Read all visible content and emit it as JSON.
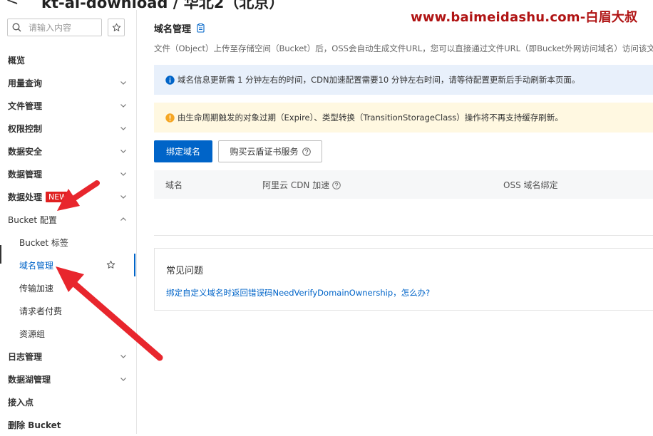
{
  "header": {
    "back_glyph": "<",
    "title": "kt-ai-download / 华北2（北京）"
  },
  "watermark": "www.baimeidashu.com-白眉大叔",
  "sidebar": {
    "search_placeholder": "请输入内容",
    "items": [
      {
        "label": "概览"
      },
      {
        "label": "用量查询"
      },
      {
        "label": "文件管理"
      },
      {
        "label": "权限控制"
      },
      {
        "label": "数据安全"
      },
      {
        "label": "数据管理"
      },
      {
        "label": "数据处理",
        "badge": "NEW"
      },
      {
        "label": "Bucket 配置"
      },
      {
        "label": "Bucket 标签"
      },
      {
        "label": "域名管理"
      },
      {
        "label": "传输加速"
      },
      {
        "label": "请求者付费"
      },
      {
        "label": "资源组"
      },
      {
        "label": "日志管理"
      },
      {
        "label": "数据湖管理"
      },
      {
        "label": "接入点"
      },
      {
        "label": "删除 Bucket"
      }
    ]
  },
  "main": {
    "title": "域名管理",
    "description": "文件（Object）上传至存储空间（Bucket）后，OSS会自动生成文件URL，您可以直接通过文件URL（即Bucket外网访问域名）访问该文",
    "info_banner": "域名信息更新需 1 分钟左右的时间，CDN加速配置需要10 分钟左右时间，请等待配置更新后手动刷新本页面。",
    "warn_banner": "由生命周期触发的对象过期（Expire）、类型转换（TransitionStorageClass）操作将不再支持缓存刷新。",
    "bind_button": "绑定域名",
    "buy_cert_button": "购买云盾证书服务",
    "table": {
      "columns": [
        "域名",
        "阿里云 CDN 加速",
        "OSS 域名绑定"
      ]
    },
    "faq": {
      "title": "常见问题",
      "link": "绑定自定义域名时返回错误码NeedVerifyDomainOwnership，怎么办?"
    }
  },
  "colors": {
    "accent": "#0064c8",
    "info_bg": "#e8f0fb",
    "warn_bg": "#fff8e1",
    "warn_icon": "#f5a623",
    "badge": "#e02020",
    "annotation": "#e8262d"
  }
}
